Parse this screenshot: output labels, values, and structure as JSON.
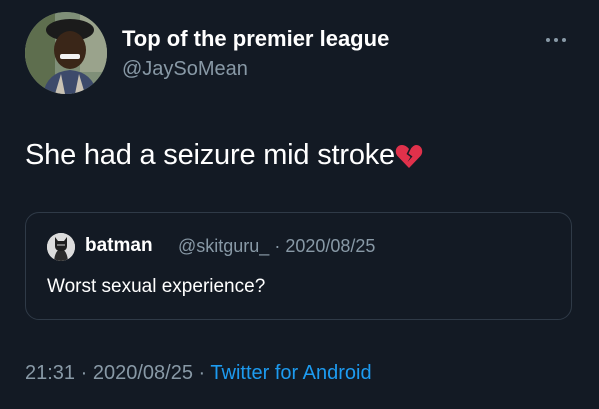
{
  "author": {
    "display_name": "Top of the premier league",
    "handle": "@JaySoMean"
  },
  "tweet": {
    "text": "She had a seizure mid stroke",
    "emoji": "💔"
  },
  "quoted_tweet": {
    "author_name": "batman",
    "author_handle": "@skitguru_",
    "separator": "·",
    "date": "2020/08/25",
    "text": "Worst sexual experience?"
  },
  "footer": {
    "time": "21:31",
    "separator": "·",
    "date": "2020/08/25",
    "separator2": "·",
    "source": "Twitter for Android"
  },
  "colors": {
    "background": "#131a24",
    "secondary_text": "#8899a6",
    "link": "#1d9bf0",
    "quote_border": "#2f3a47"
  },
  "icons": {
    "more": "more-options-icon",
    "broken_heart": "broken-heart-emoji"
  }
}
